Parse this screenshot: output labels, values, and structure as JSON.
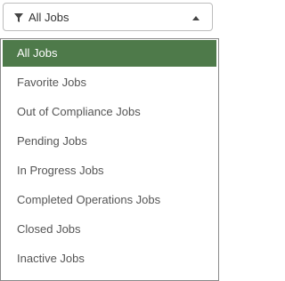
{
  "select": {
    "value": "All Jobs",
    "filter_icon": "filter-icon",
    "caret_icon": "caret-up-icon"
  },
  "menu": {
    "items": [
      {
        "label": "All Jobs",
        "selected": true
      },
      {
        "label": "Favorite Jobs",
        "selected": false
      },
      {
        "label": "Out of Compliance Jobs",
        "selected": false
      },
      {
        "label": "Pending Jobs",
        "selected": false
      },
      {
        "label": "In Progress Jobs",
        "selected": false
      },
      {
        "label": "Completed Operations Jobs",
        "selected": false
      },
      {
        "label": "Closed Jobs",
        "selected": false
      },
      {
        "label": "Inactive Jobs",
        "selected": false
      }
    ]
  },
  "colors": {
    "selected_background": "#4e7a4a",
    "selected_text": "#ffffff",
    "item_text": "#555555"
  }
}
